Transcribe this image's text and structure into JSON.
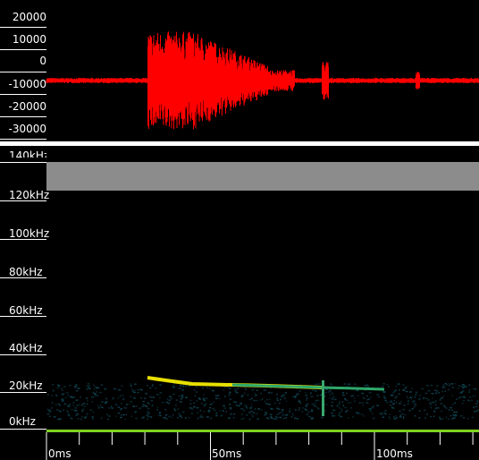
{
  "waveform": {
    "color": "#ff0000",
    "amplitude_ticks": [
      "20000",
      "10000",
      "0",
      "-10000",
      "-20000",
      "-30000"
    ]
  },
  "spectrogram": {
    "frequency_ticks": [
      "140kHz",
      "120kHz",
      "100kHz",
      "80kHz",
      "60kHz",
      "40kHz",
      "20kHz",
      "0kHz"
    ],
    "masked_band_color": "#8c8c8c",
    "call_color": "#e8e000"
  },
  "time_axis": {
    "ticks": [
      "0ms",
      "50ms",
      "100ms"
    ],
    "line_color": "#7ed321"
  }
}
